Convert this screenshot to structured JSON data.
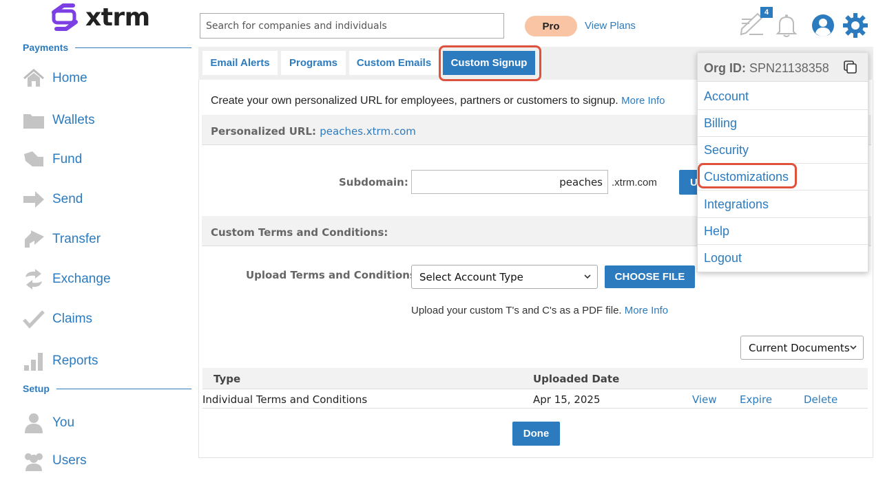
{
  "brand": {
    "name": "xtrm"
  },
  "sidebar": {
    "sections": [
      {
        "label": "Payments"
      },
      {
        "label": "Setup"
      }
    ],
    "items": [
      {
        "label": "Home",
        "icon": "home-icon"
      },
      {
        "label": "Wallets",
        "icon": "folder-icon"
      },
      {
        "label": "Fund",
        "icon": "fund-icon"
      },
      {
        "label": "Send",
        "icon": "arrow-right-icon"
      },
      {
        "label": "Transfer",
        "icon": "transfer-icon"
      },
      {
        "label": "Exchange",
        "icon": "exchange-icon"
      },
      {
        "label": "Claims",
        "icon": "checkmark-icon"
      },
      {
        "label": "Reports",
        "icon": "bar-chart-icon"
      },
      {
        "label": "You",
        "icon": "user-icon"
      },
      {
        "label": "Users",
        "icon": "users-icon"
      }
    ]
  },
  "header": {
    "search_placeholder": "Search for companies and individuals",
    "plan_badge": "Pro",
    "view_plans": "View Plans",
    "notes_count": "4"
  },
  "tabs": [
    {
      "label": "Email Alerts"
    },
    {
      "label": "Programs"
    },
    {
      "label": "Custom Emails"
    },
    {
      "label": "Custom Signup",
      "active": true
    }
  ],
  "main": {
    "intro_text": "Create your own personalized URL for employees, partners or customers to signup.",
    "more_info": "More Info",
    "personalized_url_label": "Personalized URL:",
    "personalized_url_value": "peaches.xtrm.com",
    "subdomain_label": "Subdomain:",
    "subdomain_value": "peaches",
    "subdomain_suffix": ".xtrm.com",
    "update_button": "U",
    "terms_section_label": "Custom Terms and Conditions:",
    "upload_label": "Upload Terms and Conditions:",
    "account_type_select": "Select Account Type",
    "choose_file_button": "CHOOSE FILE",
    "upload_hint": "Upload your custom T's and C's as a PDF file.",
    "documents_select": "Current Documents",
    "table": {
      "headers": [
        "Type",
        "Uploaded Date"
      ],
      "rows": [
        {
          "type": "Individual Terms and Conditions",
          "date": "Apr 15, 2025",
          "actions": [
            "View",
            "Expire",
            "Delete"
          ]
        }
      ]
    },
    "done_button": "Done"
  },
  "account_menu": {
    "org_label": "Org ID:",
    "org_id": "SPN21138358",
    "items": [
      "Account",
      "Billing",
      "Security",
      "Customizations",
      "Integrations",
      "Help",
      "Logout"
    ]
  },
  "colors": {
    "accent": "#2c7bbf",
    "highlight": "#e0513b",
    "pro_badge": "#f8c4a4",
    "logo": "#7b3fe4"
  }
}
